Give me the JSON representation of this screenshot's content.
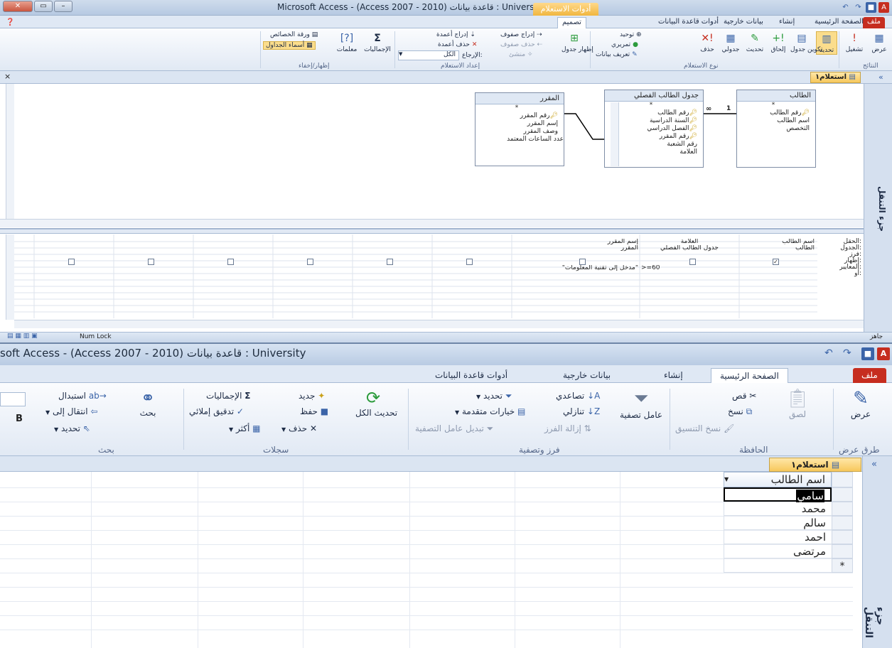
{
  "window1": {
    "title": "Microsoft Access - (Access 2007 - 2010) قاعدة بيانات : University",
    "context_tab": "أدوات الاستعلام",
    "tabs": [
      "ملف",
      "الصفحة الرئيسية",
      "إنشاء",
      "بيانات خارجية",
      "أدوات قاعدة البيانات",
      "تصميم"
    ],
    "ribbon": {
      "results": {
        "label": "النتائج",
        "view": "عرض",
        "run": "تشغيل"
      },
      "query_type": {
        "label": "نوع الاستعلام",
        "select": "تحديد",
        "make_table": "تكوين جدول",
        "append": "إلحاق",
        "update": "تحديث",
        "crosstab": "جدولي",
        "delete": "حذف",
        "union": "توحيد",
        "pass_through": "تمريري",
        "data_definition": "تعريف بيانات"
      },
      "setup": {
        "label": "إعداد الاستعلام",
        "show_table": "إظهار جدول",
        "insert_rows": "إدراج صفوف",
        "delete_rows": "حذف صفوف",
        "builder": "منشئ",
        "insert_cols": "إدراج أعمدة",
        "delete_cols": "حذف أعمدة",
        "return_label": "الإرجاع:",
        "return_value": "الكل"
      },
      "show_hide": {
        "label": "إظهار/إخفاء",
        "totals": "الإجماليات",
        "params": "معلمات",
        "prop_sheet": "ورقة الخصائص",
        "table_names": "أسماء الجداول"
      }
    },
    "doc_tab": "استعلام١",
    "nav_label": "جزء التنقل",
    "tables": [
      {
        "name": "الطالب",
        "fields": [
          "*",
          "رقم الطالب",
          "اسم الطالب",
          "التخصص"
        ],
        "keys": [
          1
        ]
      },
      {
        "name": "جدول الطالب الفصلي",
        "fields": [
          "*",
          "رقم الطالب",
          "السنة الدراسية",
          "الفصل الدراسي",
          "رقم المقرر",
          "رقم الشعبة",
          "العلامة"
        ],
        "keys": [
          1,
          2,
          3,
          4
        ]
      },
      {
        "name": "المقرر",
        "fields": [
          "*",
          "رقم المقرر",
          "إسم المقرر",
          "وصف المقرر",
          "عدد الساعات المعتمد"
        ],
        "keys": [
          1
        ]
      }
    ],
    "rel_labels": {
      "many": "∞",
      "one": "1"
    },
    "grid": {
      "row_labels": [
        "الحقل:",
        "الجدول:",
        "فرز:",
        "إظهار:",
        "المعايير:",
        "أو:"
      ],
      "columns": [
        {
          "field": "اسم الطالب",
          "table": "الطالب",
          "show": true,
          "criteria": ""
        },
        {
          "field": "العلامة",
          "table": "جدول الطالب الفصلي",
          "show": false,
          "criteria": ">=60"
        },
        {
          "field": "إسم المقرر",
          "table": "المقرر",
          "show": false,
          "criteria": "\"مدخل إلى تقنية المعلومات\""
        }
      ]
    },
    "status": {
      "ready": "جاهز",
      "num_lock": "Num Lock"
    }
  },
  "window2": {
    "title": "soft Access - (Access 2007 - 2010) قاعدة بيانات : University",
    "tabs": [
      "ملف",
      "الصفحة الرئيسية",
      "إنشاء",
      "بيانات خارجية",
      "أدوات قاعدة البيانات"
    ],
    "ribbon": {
      "views": {
        "label": "طرق عرض",
        "view": "عرض"
      },
      "clipboard": {
        "label": "الحافظة",
        "paste": "لصق",
        "cut": "قص",
        "copy": "نسخ",
        "format_painter": "نسخ التنسيق"
      },
      "sort_filter": {
        "label": "فرز وتصفية",
        "filter": "عامل تصفية",
        "ascending": "تصاعدي",
        "descending": "تنازلي",
        "remove_sort": "إزالة الفرز",
        "selection": "تحديد",
        "advanced": "خيارات متقدمة",
        "toggle_filter": "تبديل عامل التصفية"
      },
      "records": {
        "label": "سجلات",
        "refresh": "تحديث الكل",
        "new": "جديد",
        "save": "حفظ",
        "delete": "حذف",
        "totals": "الإجماليات",
        "spelling": "تدقيق إملائي",
        "more": "أكثر"
      },
      "find": {
        "label": "بحث",
        "find": "بحث",
        "replace": "استبدال",
        "goto": "انتقال إلى",
        "select": "تحديد"
      }
    },
    "doc_tab": "استعلام١",
    "nav_label": "جزء التنقل",
    "sheet": {
      "column": "اسم الطالب",
      "rows": [
        "سامي",
        "محمد",
        "سالم",
        "احمد",
        "مرتضى"
      ],
      "new_row_marker": "*"
    }
  }
}
